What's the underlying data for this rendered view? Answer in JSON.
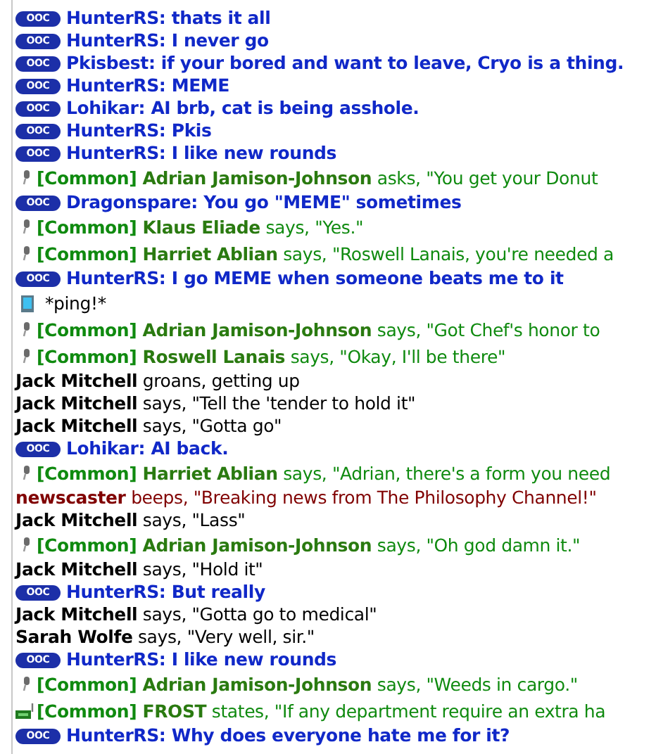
{
  "messages": [
    {
      "kind": "ooc",
      "badge": "OOC",
      "text": "HunterRS: thats it all"
    },
    {
      "kind": "ooc",
      "badge": "OOC",
      "text": "HunterRS: I never go"
    },
    {
      "kind": "ooc",
      "badge": "OOC",
      "text": "Pkisbest: if your bored and want to leave, Cryo is a thing."
    },
    {
      "kind": "ooc",
      "badge": "OOC",
      "text": "HunterRS: MEME"
    },
    {
      "kind": "ooc",
      "badge": "OOC",
      "text": "Lohikar: AI brb, cat is being asshole."
    },
    {
      "kind": "ooc",
      "badge": "OOC",
      "text": "HunterRS: Pkis"
    },
    {
      "kind": "ooc",
      "badge": "OOC",
      "text": "HunterRS: I like new rounds"
    },
    {
      "kind": "radio",
      "channel": "[Common]",
      "name": "Adrian Jamison-Johnson",
      "text": "asks, \"You get your Donut"
    },
    {
      "kind": "ooc",
      "badge": "OOC",
      "text": "Dragonspare: You go \"MEME\" sometimes"
    },
    {
      "kind": "radio",
      "channel": "[Common]",
      "name": "Klaus Eliade",
      "text": "says, \"Yes.\""
    },
    {
      "kind": "radio",
      "channel": "[Common]",
      "name": "Harriet Ablian",
      "text": "says, \"Roswell Lanais, you're needed a"
    },
    {
      "kind": "ooc",
      "badge": "OOC",
      "text": "HunterRS: I go MEME when someone beats me to it"
    },
    {
      "kind": "ping",
      "text": "*ping!*"
    },
    {
      "kind": "radio",
      "channel": "[Common]",
      "name": "Adrian Jamison-Johnson",
      "text": "says, \"Got Chef's honor to"
    },
    {
      "kind": "radio",
      "channel": "[Common]",
      "name": "Roswell Lanais",
      "text": "says, \"Okay, I'll be there\""
    },
    {
      "kind": "say",
      "name": "Jack Mitchell",
      "text": "groans, getting up"
    },
    {
      "kind": "say",
      "name": "Jack Mitchell",
      "text": "says, \"Tell the 'tender to hold it\""
    },
    {
      "kind": "say",
      "name": "Jack Mitchell",
      "text": "says, \"Gotta go\""
    },
    {
      "kind": "ooc",
      "badge": "OOC",
      "text": "Lohikar: AI back."
    },
    {
      "kind": "radio",
      "channel": "[Common]",
      "name": "Harriet Ablian",
      "text": "says, \"Adrian, there's a form you need"
    },
    {
      "kind": "machine",
      "name": "newscaster",
      "text": "beeps, \"Breaking news from The Philosophy Channel!\""
    },
    {
      "kind": "say",
      "name": "Jack Mitchell",
      "text": "says, \"Lass\""
    },
    {
      "kind": "radio",
      "channel": "[Common]",
      "name": "Adrian Jamison-Johnson",
      "text": "says, \"Oh god damn it.\""
    },
    {
      "kind": "say",
      "name": "Jack Mitchell",
      "text": "says, \"Hold it\""
    },
    {
      "kind": "ooc",
      "badge": "OOC",
      "text": "HunterRS: But really"
    },
    {
      "kind": "say",
      "name": "Jack Mitchell",
      "text": "says, \"Gotta go to medical\""
    },
    {
      "kind": "say",
      "name": "Sarah Wolfe",
      "text": "says, \"Very well, sir.\""
    },
    {
      "kind": "ooc",
      "badge": "OOC",
      "text": "HunterRS: I like new rounds"
    },
    {
      "kind": "radio",
      "channel": "[Common]",
      "name": "Adrian Jamison-Johnson",
      "text": "says, \"Weeds in cargo.\""
    },
    {
      "kind": "intercom",
      "channel": "[Common]",
      "name": "FROST",
      "text": "states, \"If any department require an extra ha"
    },
    {
      "kind": "ooc",
      "badge": "OOC",
      "text": "HunterRS: Why does everyone hate me for it?"
    }
  ]
}
